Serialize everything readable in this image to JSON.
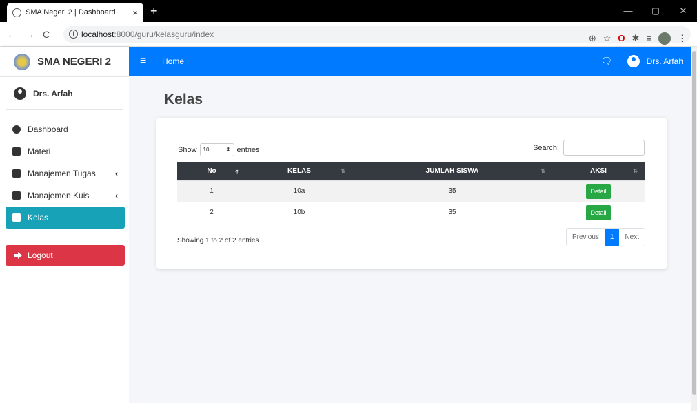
{
  "browser": {
    "tab_title": "SMA Negeri 2 | Dashboard",
    "tab_close": "×",
    "new_tab": "+",
    "url_host": "localhost",
    "url_path": ":8000/guru/kelasguru/index",
    "win_min": "—",
    "win_max": "▢",
    "win_close": "✕"
  },
  "sidebar": {
    "brand": "SMA NEGERI 2",
    "user": "Drs. Arfah",
    "items": [
      {
        "label": "Dashboard"
      },
      {
        "label": "Materi"
      },
      {
        "label": "Manajemen Tugas",
        "chev": "‹"
      },
      {
        "label": "Manajemen Kuis",
        "chev": "‹"
      },
      {
        "label": "Kelas"
      }
    ],
    "logout": "Logout"
  },
  "topbar": {
    "hamburger": "≡",
    "home": "Home",
    "user": "Drs. Arfah",
    "msg_icon": "🗨"
  },
  "page": {
    "title": "Kelas"
  },
  "table_controls": {
    "show": "Show",
    "entries_value": "10",
    "entries": "entries",
    "search": "Search:"
  },
  "table": {
    "headers": [
      "No",
      "KELAS",
      "JUMLAH SISWA",
      "AKSI"
    ],
    "rows": [
      {
        "no": "1",
        "kelas": "10a",
        "jumlah": "35",
        "aksi": "Detail"
      },
      {
        "no": "2",
        "kelas": "10b",
        "jumlah": "35",
        "aksi": "Detail"
      }
    ]
  },
  "info": "Showing 1 to 2 of 2 entries",
  "pager": {
    "prev": "Previous",
    "page": "1",
    "next": "Next"
  },
  "colors": {
    "primary": "#007bff",
    "active": "#17a2b8",
    "danger": "#dc3545",
    "success": "#28a745",
    "header": "#343a40"
  }
}
